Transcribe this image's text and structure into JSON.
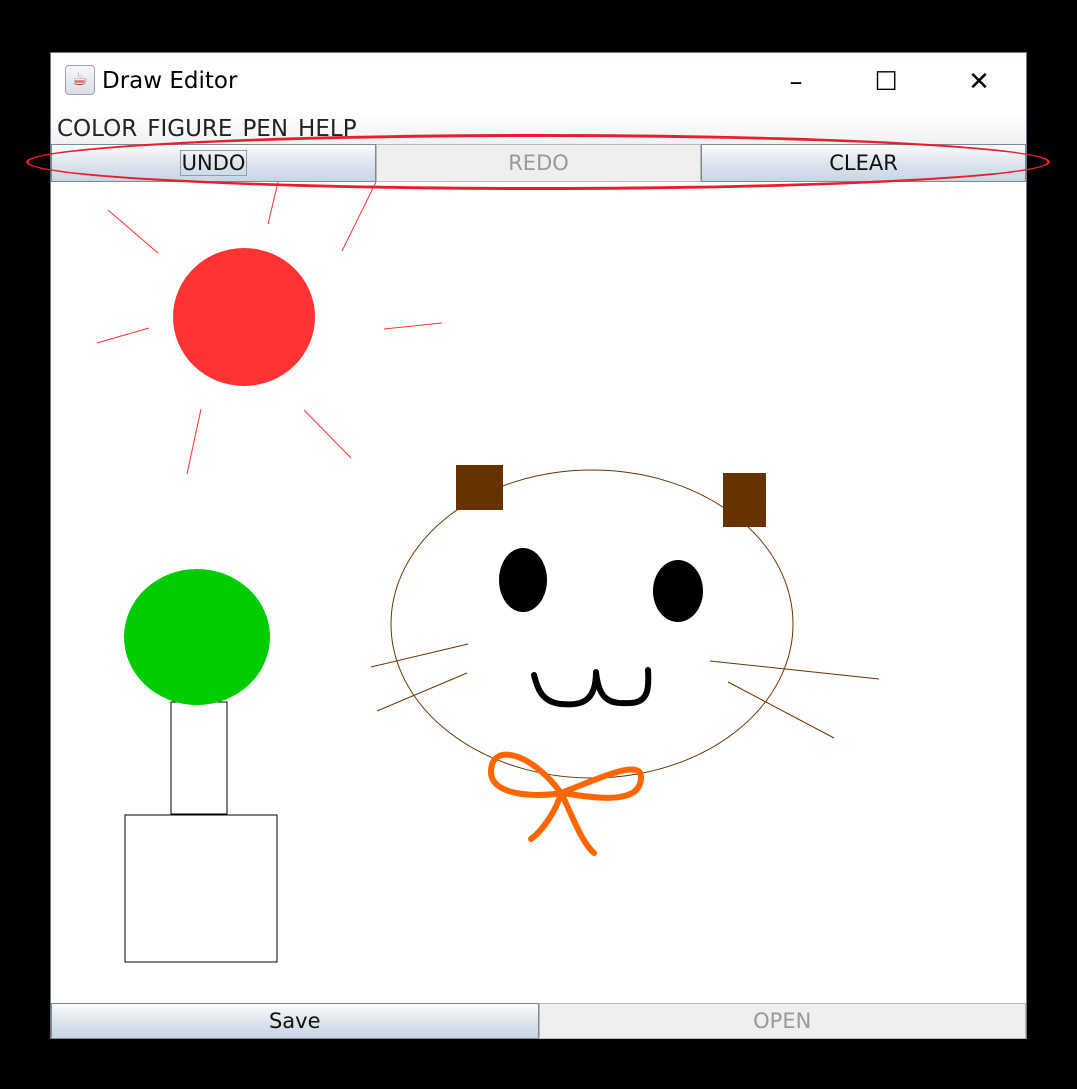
{
  "window": {
    "title": "Draw Editor",
    "app_icon": "java-icon",
    "controls": {
      "minimize": "–",
      "maximize": "☐",
      "close": "✕"
    }
  },
  "menu": {
    "items": [
      "COLOR",
      "FIGURE",
      "PEN",
      "HELP"
    ]
  },
  "toolbar": {
    "undo_label": "UNDO",
    "redo_label": "REDO",
    "clear_label": "CLEAR"
  },
  "bottom": {
    "save_label": "Save",
    "open_label": "OPEN"
  },
  "canvas": {
    "shapes": [
      "sun",
      "sun-rays",
      "tree-crown",
      "tree-trunk",
      "flower-pot",
      "cat-face",
      "cat-ears",
      "cat-eyes",
      "cat-mouth",
      "cat-whiskers",
      "bow"
    ],
    "colors": {
      "sun": "#ff3333",
      "tree": "#00cc00",
      "ears": "#663300",
      "bow": "#ff6600",
      "eyes": "#000000"
    }
  }
}
